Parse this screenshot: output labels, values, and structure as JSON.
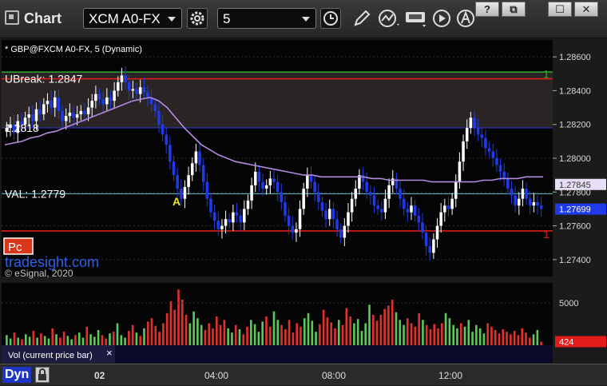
{
  "app": {
    "title": "Chart"
  },
  "toolbar": {
    "symbol": "XCM A0-FX",
    "interval": "5"
  },
  "window_buttons": [
    "?",
    "⧉",
    "☐",
    "✕"
  ],
  "colors": {
    "up_bar": "#ffffff",
    "down_bar": "#1f3ae8",
    "ma_line": "#b28ae0",
    "ubreak_line": "#2ea82e",
    "red_line": "#e31b1b",
    "pivot_line": "#2d3ad0",
    "val_line": "#5fc9d6",
    "upper_band_bg": "#2a2424",
    "panel_bg": "#050505"
  },
  "chart_data": {
    "type": "candlestick",
    "header": "* GBP@FXCM A0-FX, 5 (Dynamic)",
    "y_ticks": [
      "1.28600",
      "1.28400",
      "1.28200",
      "1.28000",
      "1.27800",
      "1.27600",
      "1.27400"
    ],
    "ylim": [
      1.273,
      1.287
    ],
    "x_ticks": [
      "02",
      "04:00",
      "08:00",
      "12:00"
    ],
    "levels": [
      {
        "label": "UBreak: 1.2847",
        "value": 1.2847,
        "marker": "1"
      },
      {
        "label": "1.2818",
        "value": 1.2818
      },
      {
        "label": "VAL: 1.2779",
        "value": 1.2779
      },
      {
        "label": "",
        "value": 1.2757,
        "marker": "1"
      }
    ],
    "ubreak_green_value": 1.2851,
    "last_price_tags": [
      "1.27845",
      "1.27699"
    ],
    "ma_last": 1.27845,
    "last_close": 1.27699,
    "annotation": "A",
    "badge": "Pc",
    "watermark": "tradesight.com",
    "copyright": "© eSignal, 2020",
    "closes": [
      1.2818,
      1.282,
      1.2815,
      1.2822,
      1.282,
      1.2824,
      1.2826,
      1.2822,
      1.2829,
      1.2826,
      1.2832,
      1.2834,
      1.283,
      1.2836,
      1.2828,
      1.2822,
      1.2825,
      1.2827,
      1.2824,
      1.2826,
      1.2828,
      1.2826,
      1.283,
      1.2834,
      1.2838,
      1.2835,
      1.2832,
      1.2836,
      1.2834,
      1.284,
      1.2845,
      1.2849,
      1.2845,
      1.284,
      1.2841,
      1.2838,
      1.2842,
      1.2839,
      1.2836,
      1.2832,
      1.2828,
      1.282,
      1.2814,
      1.2808,
      1.2798,
      1.279,
      1.2782,
      1.2776,
      1.2783,
      1.279,
      1.2797,
      1.2804,
      1.2796,
      1.2786,
      1.2776,
      1.2768,
      1.2763,
      1.2758,
      1.276,
      1.2764,
      1.2762,
      1.2768,
      1.2766,
      1.2762,
      1.277,
      1.2775,
      1.2784,
      1.2792,
      1.2786,
      1.2782,
      1.2784,
      1.2788,
      1.2786,
      1.278,
      1.2774,
      1.2766,
      1.276,
      1.2756,
      1.2758,
      1.277,
      1.2782,
      1.279,
      1.2786,
      1.278,
      1.2774,
      1.2769,
      1.2764,
      1.277,
      1.2764,
      1.2758,
      1.2753,
      1.276,
      1.2768,
      1.2776,
      1.2782,
      1.279,
      1.2786,
      1.278,
      1.2778,
      1.2772,
      1.277,
      1.2768,
      1.2776,
      1.2784,
      1.2788,
      1.2782,
      1.2776,
      1.277,
      1.2768,
      1.2772,
      1.2766,
      1.2762,
      1.2756,
      1.2748,
      1.2744,
      1.2752,
      1.276,
      1.2768,
      1.2772,
      1.277,
      1.2776,
      1.2786,
      1.2798,
      1.281,
      1.2818,
      1.2824,
      1.2818,
      1.2814,
      1.2812,
      1.2806,
      1.2804,
      1.28,
      1.2796,
      1.2792,
      1.2788,
      1.2782,
      1.2778,
      1.2772,
      1.2776,
      1.2782,
      1.2776,
      1.2772,
      1.2774,
      1.2772,
      1.277
    ],
    "ma_values": [
      1.2808,
      1.2809,
      1.281,
      1.2812,
      1.2813,
      1.2815,
      1.2816,
      1.2818,
      1.282,
      1.2822,
      1.2824,
      1.2826,
      1.2828,
      1.283,
      1.2832,
      1.2834,
      1.2835,
      1.2836,
      1.2834,
      1.283,
      1.2824,
      1.2818,
      1.2813,
      1.2808,
      1.2805,
      1.2802,
      1.28,
      1.2798,
      1.2797,
      1.2796,
      1.2795,
      1.2794,
      1.2793,
      1.2792,
      1.2791,
      1.279,
      1.279,
      1.2789,
      1.2789,
      1.2789,
      1.2789,
      1.2789,
      1.2789,
      1.2788,
      1.2788,
      1.2787,
      1.2787,
      1.2787,
      1.2787,
      1.2787,
      1.2786,
      1.2786,
      1.2786,
      1.2786,
      1.2786,
      1.2786,
      1.2787,
      1.2787,
      1.2788,
      1.2788,
      1.2788,
      1.2789,
      1.2789,
      1.2789
    ],
    "volume": {
      "label": "Vol (current price bar)",
      "y_tick": "5000",
      "last": "424",
      "ymax": 7000,
      "values": [
        1200,
        800,
        1500,
        900,
        700,
        1300,
        1000,
        1700,
        900,
        1400,
        1100,
        800,
        2000,
        1300,
        900,
        1600,
        1100,
        700,
        1200,
        1500,
        900,
        2200,
        1300,
        1000,
        1800,
        1200,
        800,
        1400,
        1600,
        2600,
        1200,
        900,
        1700,
        2400,
        1500,
        1100,
        2000,
        2800,
        3200,
        2300,
        1600,
        2600,
        3800,
        5200,
        4200,
        6600,
        5400,
        3600,
        2600,
        4000,
        3200,
        2400,
        1800,
        2600,
        2000,
        3400,
        2400,
        3000,
        2000,
        1500,
        2400,
        1900,
        1300,
        2200,
        3000,
        2500,
        1600,
        2800,
        3400,
        2200,
        4000,
        3000,
        2400,
        1900,
        3000,
        1500,
        2600,
        2200,
        3200,
        3800,
        2900,
        1600,
        2500,
        4200,
        3300,
        2700,
        2000,
        3000,
        2400,
        4400,
        3400,
        2600,
        3100,
        1700,
        2600,
        4800,
        3600,
        2900,
        3600,
        4300,
        4700,
        5400,
        3900,
        3000,
        2400,
        3200,
        2600,
        2200,
        3800,
        3000,
        2400,
        1900,
        2500,
        2000,
        2600,
        3800,
        3200,
        2400,
        2000,
        2600,
        2200,
        3000,
        1600,
        2400,
        2000,
        1400,
        2600,
        2200,
        1800,
        1400,
        1900,
        1600,
        1300,
        1700,
        1200,
        2000,
        1500,
        900,
        1300,
        1800,
        424
      ]
    }
  },
  "footer": {
    "dyn_label": "Dyn"
  }
}
